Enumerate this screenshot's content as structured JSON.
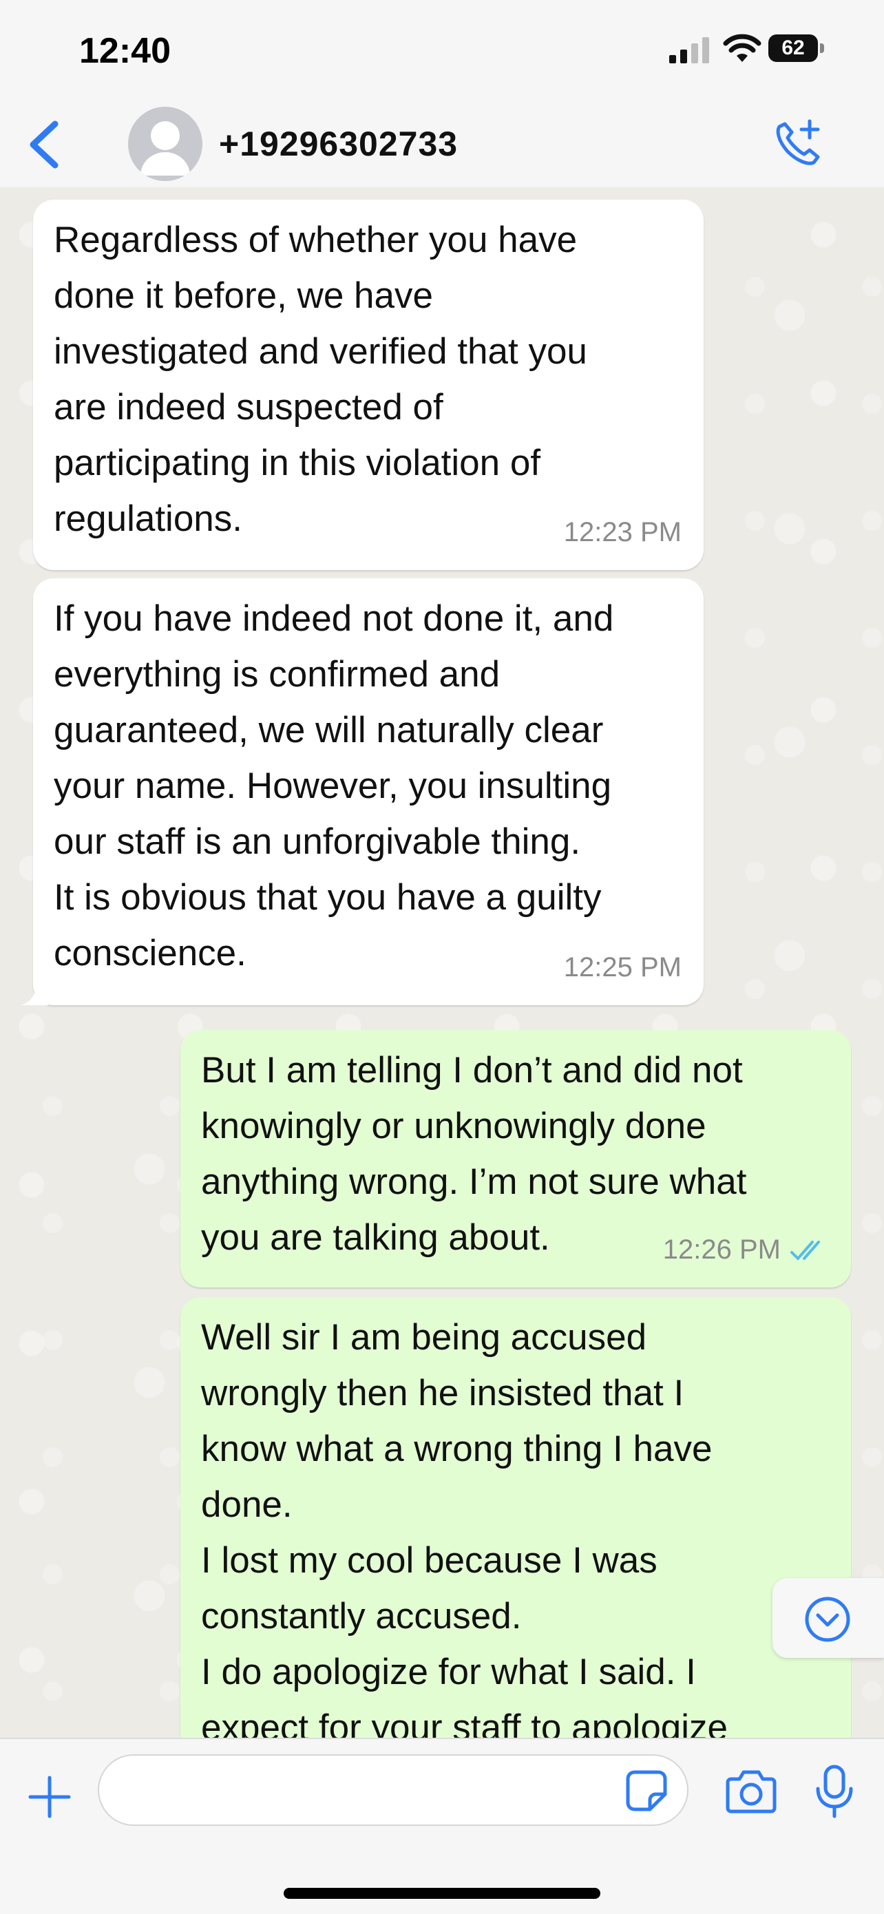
{
  "status_bar": {
    "time": "12:40",
    "battery": "62"
  },
  "header": {
    "contact_name": "+19296302733"
  },
  "messages": [
    {
      "direction": "in",
      "text": "Regardless of whether you have\ndone it before, we have\ninvestigated and verified that you\nare indeed suspected of\nparticipating in this violation of\nregulations.",
      "time": "12:23 PM"
    },
    {
      "direction": "in",
      "text": "If you have indeed not done it, and\neverything is confirmed and\nguaranteed, we will naturally clear\nyour name. However, you insulting\nour staff is an unforgivable thing.\nIt is obvious that you have a guilty\nconscience.",
      "time": "12:25 PM"
    },
    {
      "direction": "out",
      "text": "But I am telling I don’t and did not\nknowingly or unknowingly done\nanything wrong. I’m not sure what\nyou are talking about.",
      "time": "12:26 PM",
      "status": "read"
    },
    {
      "direction": "out",
      "text": "Well sir I am being accused\nwrongly then he insisted that I\nknow what a wrong thing I have\ndone.\nI lost my cool because I was\nconstantly accused.\nI do apologize for what I said. I\nexpect for your staff to apologize"
    }
  ],
  "input": {
    "placeholder": ""
  },
  "colors": {
    "accent": "#2f7bf5",
    "outgoing_bubble": "#e3fdd3",
    "incoming_bubble": "#ffffff",
    "read_ticks": "#53bdeb"
  },
  "icons": [
    "back-chevron-icon",
    "avatar-placeholder-icon",
    "add-call-icon",
    "scroll-down-icon",
    "plus-icon",
    "sticker-icon",
    "camera-icon",
    "microphone-icon"
  ]
}
